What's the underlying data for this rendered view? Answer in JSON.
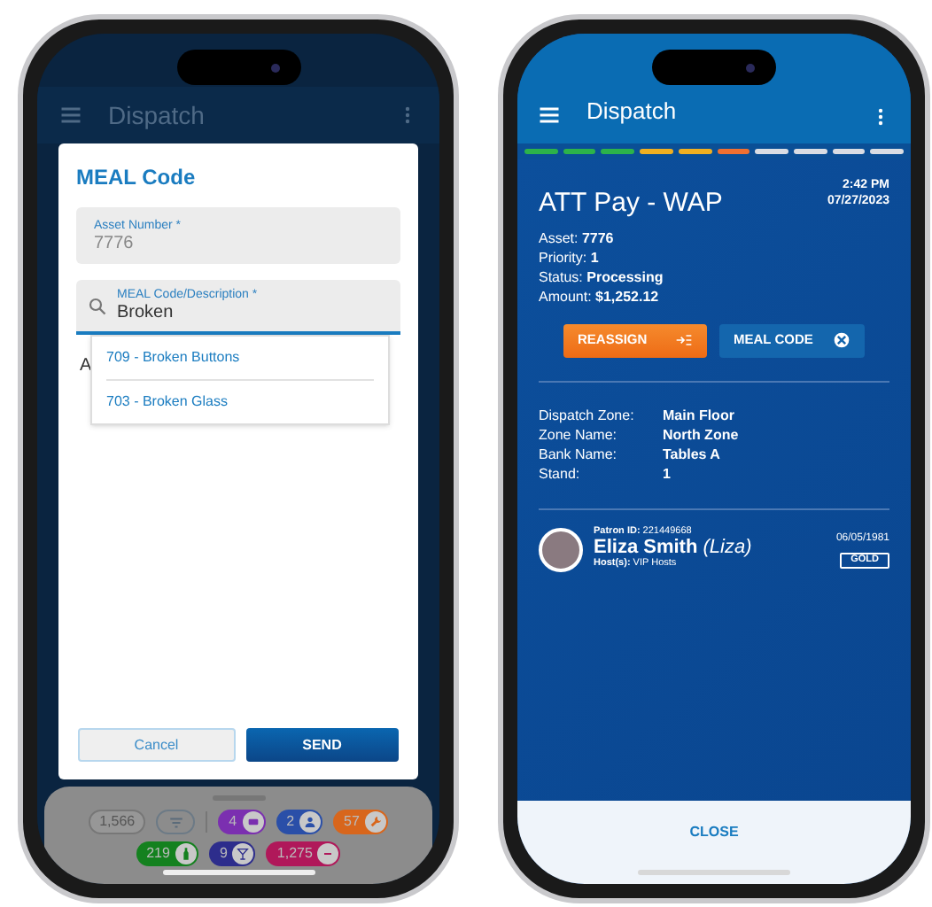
{
  "left_screen": {
    "app_bar": {
      "title": "Dispatch"
    },
    "dialog": {
      "title": "MEAL Code",
      "fields": [
        {
          "kind": "readonly",
          "label": "Asset Number *",
          "value": "7776"
        },
        {
          "kind": "search",
          "label": "MEAL Code/Description *",
          "value": "Broken"
        }
      ],
      "covered_text": "A",
      "options": [
        "709 - Broken Buttons",
        "703 - Broken Glass"
      ],
      "buttons": [
        {
          "kind": "secondary",
          "label": "Cancel"
        },
        {
          "kind": "primary",
          "label": "SEND"
        }
      ]
    },
    "bottom_sheet": {
      "rows": [
        [
          {
            "kind": "total",
            "count": "1,566"
          },
          {
            "kind": "filter"
          },
          {
            "kind": "divider"
          },
          {
            "kind": "ticket",
            "count": "4",
            "color": "#7b2fb0"
          },
          {
            "kind": "person",
            "count": "2",
            "color": "#2a4fa8"
          },
          {
            "kind": "wrench",
            "count": "57",
            "color": "#d8661c"
          }
        ],
        [
          {
            "kind": "bottle",
            "count": "219",
            "color": "#14811f"
          },
          {
            "kind": "cocktail",
            "count": "9",
            "color": "#2d2d8c"
          },
          {
            "kind": "minus",
            "count": "1,275",
            "color": "#b0185a"
          }
        ]
      ]
    }
  },
  "right_screen": {
    "app_bar": {
      "title": "Dispatch"
    },
    "status_segments": [
      {
        "color": "#2cb34a"
      },
      {
        "color": "#2cb34a"
      },
      {
        "color": "#2cb34a"
      },
      {
        "color": "#f0b020"
      },
      {
        "color": "#f0b020"
      },
      {
        "color": "#f07030"
      },
      {
        "color": "#d9dde3"
      },
      {
        "color": "#d9dde3"
      },
      {
        "color": "#d9dde3"
      },
      {
        "color": "#d9dde3"
      }
    ],
    "card": {
      "title": "ATT Pay - WAP",
      "time": "2:42 PM",
      "date": "07/27/2023",
      "details": [
        {
          "label": "Asset:",
          "value": "7776"
        },
        {
          "label": "Priority:",
          "value": "1"
        },
        {
          "label": "Status:",
          "value": "Processing"
        },
        {
          "label": "Amount:",
          "value": "$1,252.12"
        }
      ],
      "buttons": [
        {
          "kind": "reassign",
          "label": "REASSIGN"
        },
        {
          "kind": "meal_code",
          "label": "MEAL CODE"
        }
      ],
      "location": [
        {
          "label": "Dispatch Zone:",
          "value": "Main Floor"
        },
        {
          "label": "Zone Name:",
          "value": "North Zone"
        },
        {
          "label": "Bank Name:",
          "value": "Tables A"
        },
        {
          "label": "Stand:",
          "value": "1"
        }
      ],
      "patron": {
        "id_label": "Patron ID:",
        "id": "221449668",
        "name": "Eliza Smith",
        "nickname": "(Liza)",
        "hosts_label": "Host(s):",
        "hosts": "VIP Hosts",
        "date": "06/05/1981",
        "tier": "GOLD"
      }
    },
    "footer": {
      "button": "CLOSE"
    }
  }
}
